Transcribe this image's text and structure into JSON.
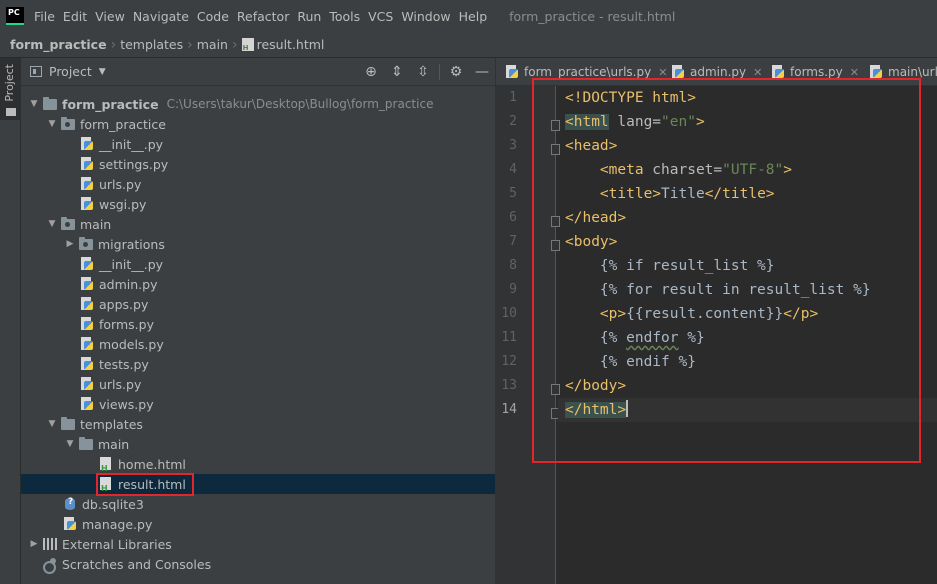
{
  "window": {
    "title": "form_practice - result.html",
    "app_icon_label": "PC"
  },
  "menu": [
    "File",
    "Edit",
    "View",
    "Navigate",
    "Code",
    "Refactor",
    "Run",
    "Tools",
    "VCS",
    "Window",
    "Help"
  ],
  "breadcrumb": [
    "form_practice",
    "templates",
    "main",
    "result.html"
  ],
  "tool_window_label": "Project",
  "project_panel": {
    "title": "Project",
    "tree": [
      {
        "label": "form_practice",
        "hint": "C:\\Users\\takur\\Desktop\\Bullog\\form_practice"
      },
      {
        "label": "form_practice"
      },
      {
        "label": "__init__.py"
      },
      {
        "label": "settings.py"
      },
      {
        "label": "urls.py"
      },
      {
        "label": "wsgi.py"
      },
      {
        "label": "main"
      },
      {
        "label": "migrations"
      },
      {
        "label": "__init__.py"
      },
      {
        "label": "admin.py"
      },
      {
        "label": "apps.py"
      },
      {
        "label": "forms.py"
      },
      {
        "label": "models.py"
      },
      {
        "label": "tests.py"
      },
      {
        "label": "urls.py"
      },
      {
        "label": "views.py"
      },
      {
        "label": "templates"
      },
      {
        "label": "main"
      },
      {
        "label": "home.html"
      },
      {
        "label": "result.html"
      },
      {
        "label": "db.sqlite3"
      },
      {
        "label": "manage.py"
      },
      {
        "label": "External Libraries"
      },
      {
        "label": "Scratches and Consoles"
      }
    ]
  },
  "editor": {
    "tabs": [
      "form_practice\\urls.py",
      "admin.py",
      "forms.py",
      "main\\urls"
    ],
    "line_numbers": [
      "1",
      "2",
      "3",
      "4",
      "5",
      "6",
      "7",
      "8",
      "9",
      "10",
      "11",
      "12",
      "13",
      "14"
    ],
    "code": {
      "l1": "<!DOCTYPE html>",
      "l2_tag": "<html",
      "l2_attr": " lang=",
      "l2_str": "\"en\"",
      "l2_end": ">",
      "l3": "<head>",
      "l4_tag": "<meta",
      "l4_attr": " charset=",
      "l4_str": "\"UTF-8\"",
      "l4_end": ">",
      "l5_open": "<title>",
      "l5_text": "Title",
      "l5_close": "</title>",
      "l6": "</head>",
      "l7": "<body>",
      "l8": "{% if result_list %}",
      "l9": "{% for result in result_list %}",
      "l10_open": "<p>",
      "l10_text": "{{result.content}}",
      "l10_close": "</p>",
      "l11_a": "{% ",
      "l11_b": "endfor",
      "l11_c": " %}",
      "l12": "{% endif %}",
      "l13": "</body>",
      "l14": "</html>"
    }
  },
  "colors": {
    "highlight_box": "#e3262b",
    "selection": "#0d293e",
    "tag": "#e8bf6a",
    "string": "#6a8759"
  }
}
